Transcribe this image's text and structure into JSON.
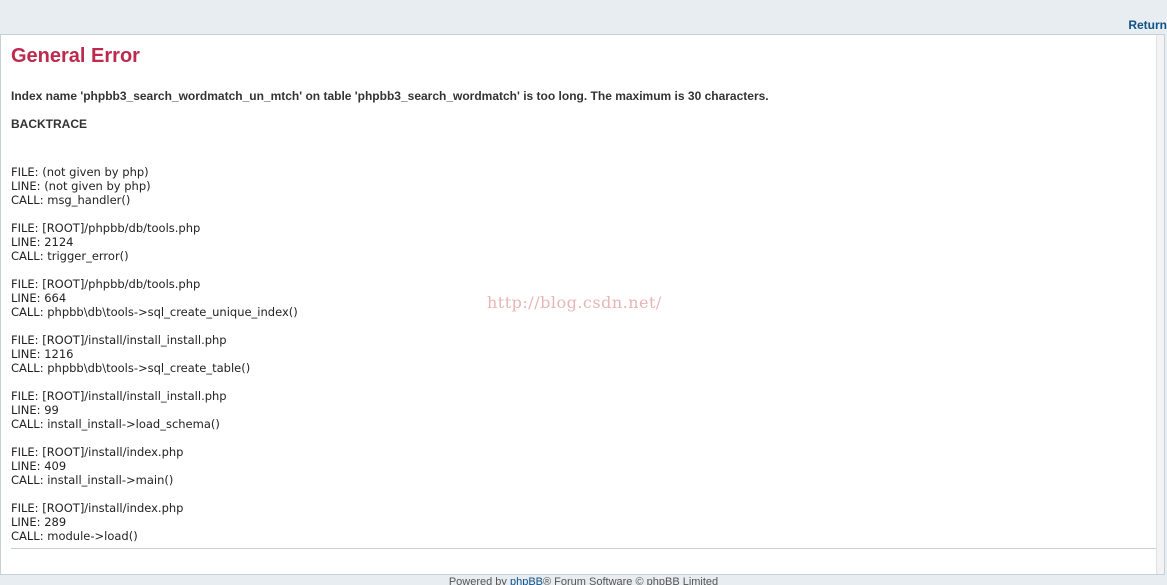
{
  "header": {
    "return_label": "Return"
  },
  "error": {
    "title": "General Error",
    "message": "Index name 'phpbb3_search_wordmatch_un_mtch' on table 'phpbb3_search_wordmatch' is too long. The maximum is 30 characters.",
    "backtrace_heading": "BACKTRACE"
  },
  "backtrace": [
    {
      "file": "FILE: (not given by php)",
      "line": "LINE: (not given by php)",
      "call": "CALL: msg_handler()"
    },
    {
      "file": "FILE: [ROOT]/phpbb/db/tools.php",
      "line": "LINE: 2124",
      "call": "CALL: trigger_error()"
    },
    {
      "file": "FILE: [ROOT]/phpbb/db/tools.php",
      "line": "LINE: 664",
      "call": "CALL: phpbb\\db\\tools->sql_create_unique_index()"
    },
    {
      "file": "FILE: [ROOT]/install/install_install.php",
      "line": "LINE: 1216",
      "call": "CALL: phpbb\\db\\tools->sql_create_table()"
    },
    {
      "file": "FILE: [ROOT]/install/install_install.php",
      "line": "LINE: 99",
      "call": "CALL: install_install->load_schema()"
    },
    {
      "file": "FILE: [ROOT]/install/index.php",
      "line": "LINE: 409",
      "call": "CALL: install_install->main()"
    },
    {
      "file": "FILE: [ROOT]/install/index.php",
      "line": "LINE: 289",
      "call": "CALL: module->load()"
    }
  ],
  "watermark": "http://blog.csdn.net/",
  "footer": {
    "prefix": "Powered by ",
    "link": "phpBB",
    "suffix": "® Forum Software © phpBB Limited"
  }
}
